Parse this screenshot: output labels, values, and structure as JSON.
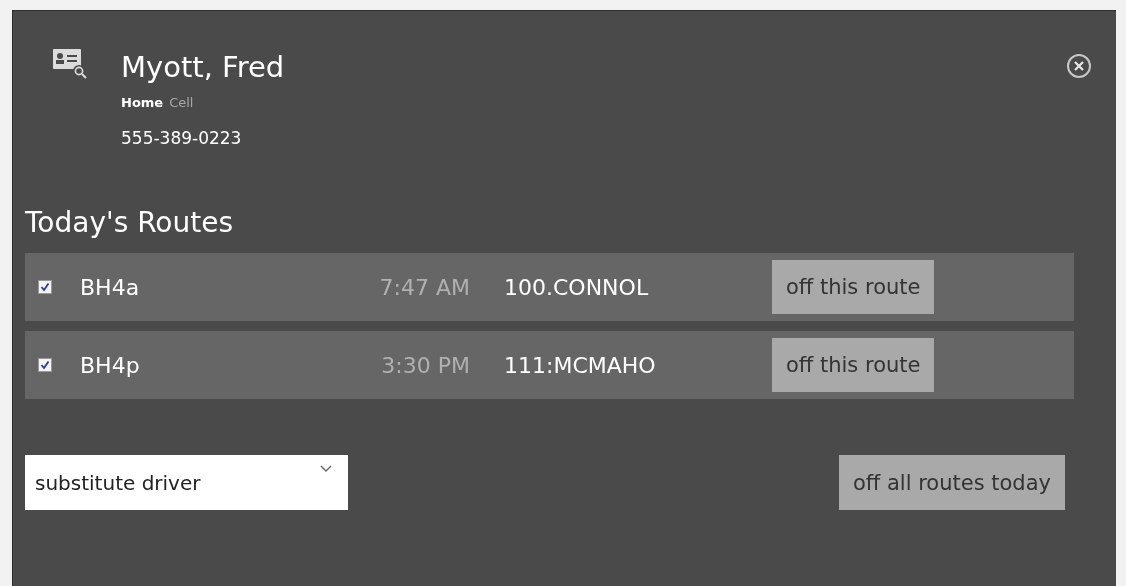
{
  "contact": {
    "name": "Myott, Fred",
    "phone_types": [
      {
        "label": "Home",
        "selected": true
      },
      {
        "label": "Cell",
        "selected": false
      }
    ],
    "phone": "555-389-0223"
  },
  "routes_title": "Today's Routes",
  "routes": [
    {
      "checked": true,
      "name": "BH4a",
      "time": "7:47 AM",
      "code": "100.CONNOL",
      "action": "off this route"
    },
    {
      "checked": true,
      "name": "BH4p",
      "time": "3:30 PM",
      "code": "111:MCMAHO",
      "action": "off this route"
    }
  ],
  "reason": {
    "value": "substitute driver"
  },
  "all_button": "off all routes today"
}
